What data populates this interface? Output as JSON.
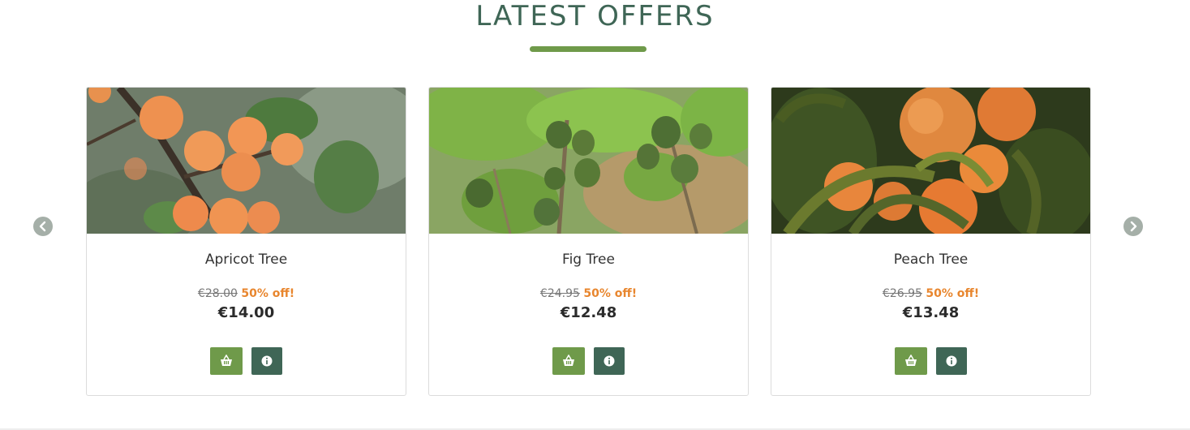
{
  "section": {
    "title": "LATEST OFFERS"
  },
  "colors": {
    "heading": "#3f6656",
    "accent_green": "#6f9a4a",
    "dark_green": "#3f6656",
    "discount_orange": "#e8862e"
  },
  "carousel": {
    "prev_icon": "chevron-left-icon",
    "next_icon": "chevron-right-icon"
  },
  "products": [
    {
      "name": "Apricot Tree",
      "old_price": "€28.00",
      "discount": "50% off!",
      "price": "€14.00",
      "image": "apricot-tree-photo"
    },
    {
      "name": "Fig Tree",
      "old_price": "€24.95",
      "discount": "50% off!",
      "price": "€12.48",
      "image": "fig-tree-photo"
    },
    {
      "name": "Peach Tree",
      "old_price": "€26.95",
      "discount": "50% off!",
      "price": "€13.48",
      "image": "peach-tree-photo"
    }
  ],
  "actions": {
    "basket_icon": "basket-icon",
    "info_icon": "info-icon"
  }
}
